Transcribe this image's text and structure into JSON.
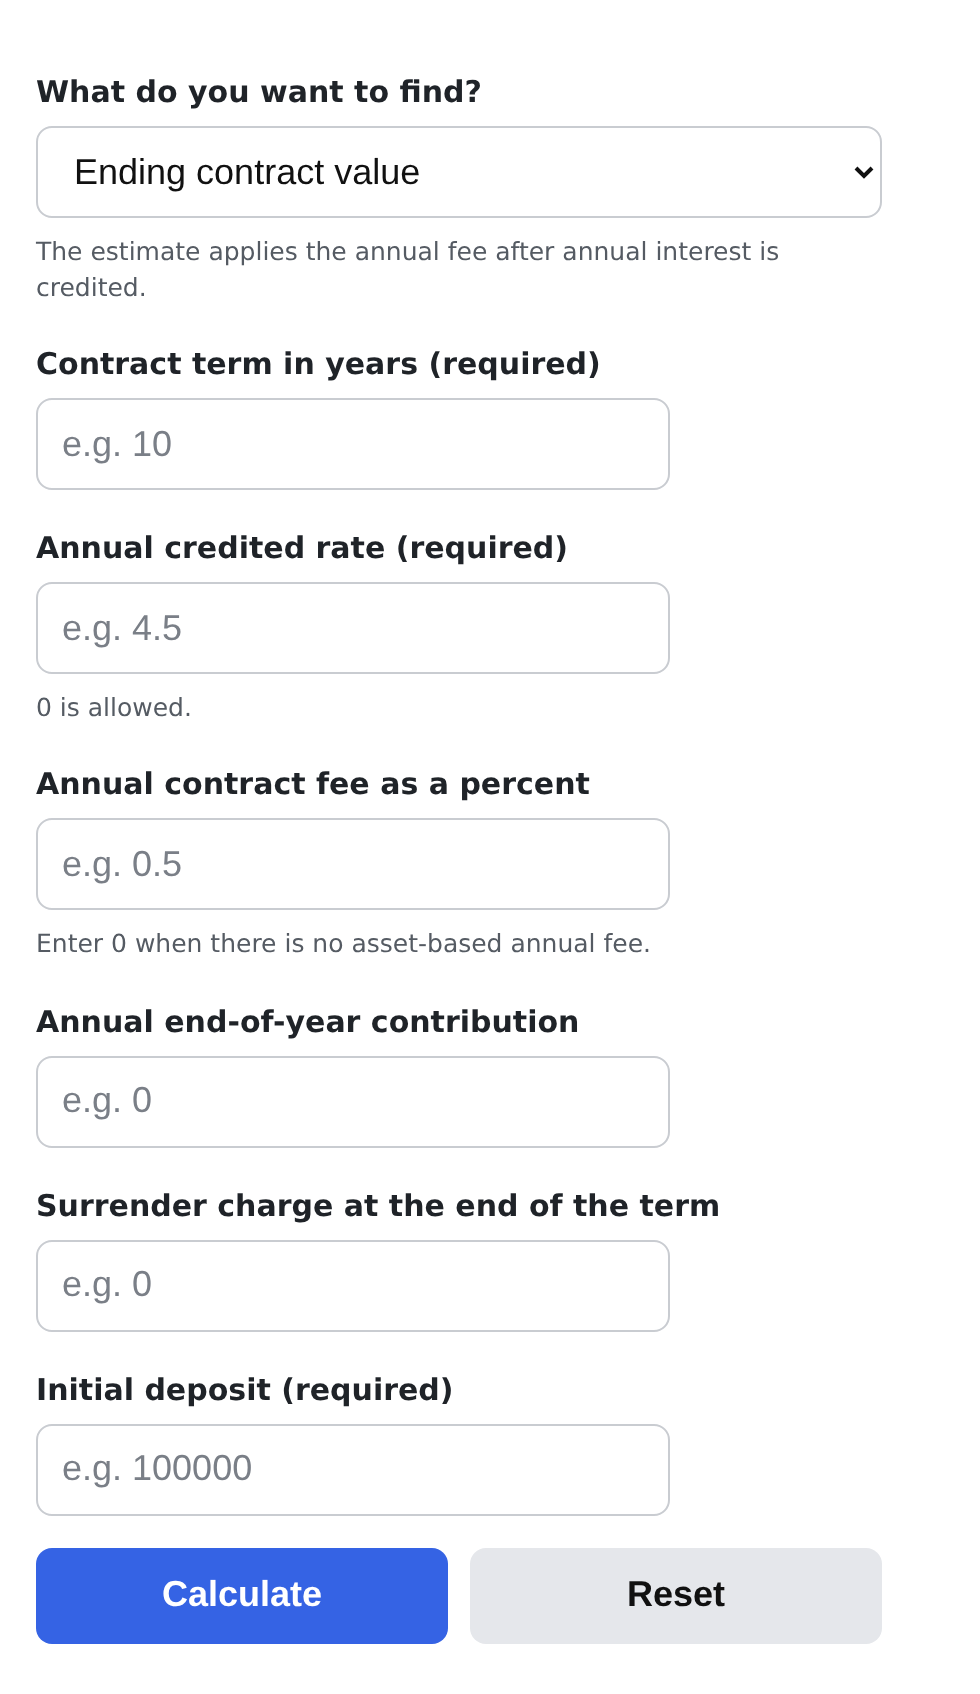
{
  "goal": {
    "label": "What do you want to find?",
    "value": "Ending contract value",
    "hint": "The estimate applies the annual fee after annual interest is credited."
  },
  "fields": [
    {
      "label": "Contract term in years (required)",
      "placeholder": "e.g. 10"
    },
    {
      "label": "Annual credited rate (required)",
      "placeholder": "e.g. 4.5",
      "hint": "0 is allowed."
    },
    {
      "label": "Annual contract fee as a percent",
      "placeholder": "e.g. 0.5",
      "hint": "Enter 0 when there is no asset-based annual fee."
    },
    {
      "label": "Annual end-of-year contribution",
      "placeholder": "e.g. 0"
    },
    {
      "label": "Surrender charge at the end of the term",
      "placeholder": "e.g. 0"
    },
    {
      "label": "Initial deposit (required)",
      "placeholder": "e.g. 100000"
    }
  ],
  "buttons": [
    {
      "label": "Calculate",
      "kind": "primary"
    },
    {
      "label": "Reset",
      "kind": "secondary"
    }
  ]
}
